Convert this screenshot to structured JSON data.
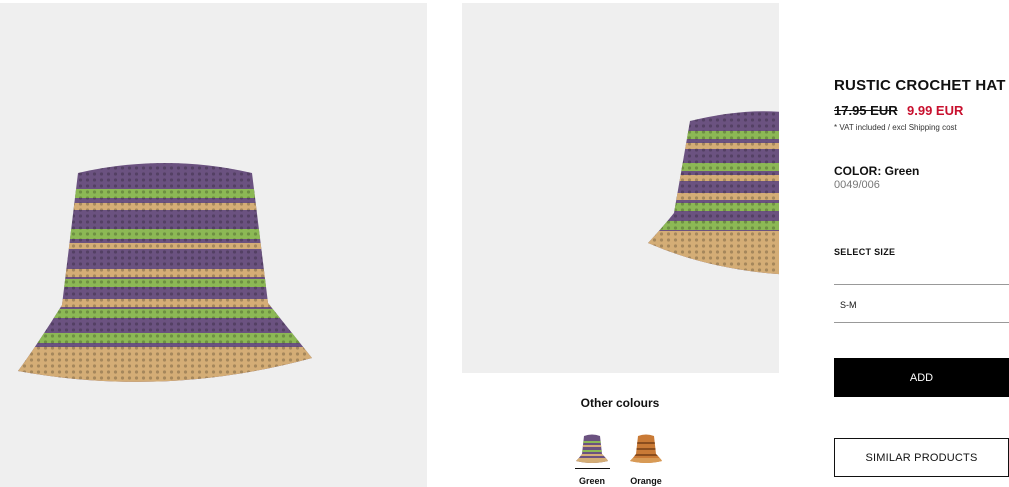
{
  "product": {
    "title": "RUSTIC CROCHET HAT",
    "price_old": "17.95 EUR",
    "price_new": "9.99 EUR",
    "vat_note": "* VAT included / excl Shipping cost",
    "color_label": "COLOR: Green",
    "sku": "0049/006"
  },
  "gallery": {
    "main_image_alt": "Rustic crochet bucket hat, green, front view",
    "second_image_alt": "Rustic crochet bucket hat, green, side view"
  },
  "other_colours": {
    "title": "Other colours",
    "swatches": [
      {
        "label": "Green",
        "selected": true
      },
      {
        "label": "Orange",
        "selected": false
      }
    ]
  },
  "size": {
    "label": "SELECT SIZE",
    "options": [
      "S-M"
    ]
  },
  "buttons": {
    "add": "ADD",
    "similar": "SIMILAR PRODUCTS"
  },
  "colors": {
    "sale_price": "#c8102e",
    "panel_bg": "#efefef",
    "hat_purple": "#6b5280",
    "hat_green": "#8cb855",
    "hat_tan": "#d4ad76",
    "hat_orange": "#c97a36"
  }
}
